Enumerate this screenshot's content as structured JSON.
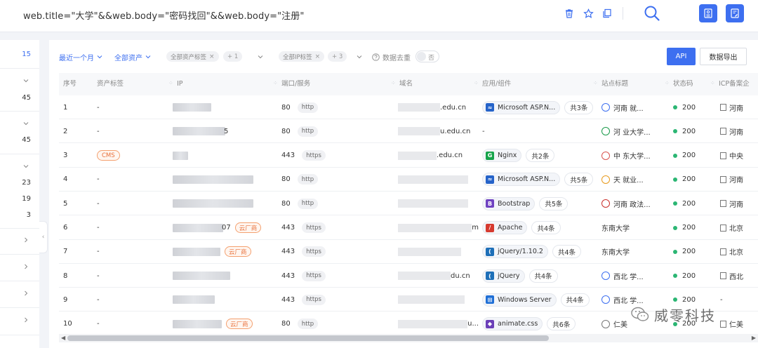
{
  "search": {
    "query": "web.title=\"大学\"&&web.body=\"密码找回\"&&web.body=\"注册\""
  },
  "facets": {
    "values": [
      "15",
      "45",
      "45",
      "23",
      "19",
      "3"
    ]
  },
  "filters": {
    "time": "最近一个月",
    "assets": "全部资产",
    "asset_tag_chip": "全部资产标签",
    "asset_tag_more": "+ 1",
    "ip_tag_chip": "全部IP标签",
    "ip_tag_more": "+ 3",
    "dedup_label": "数据去重",
    "dedup_state": "否"
  },
  "actions": {
    "api": "API",
    "export": "数据导出"
  },
  "table": {
    "columns": [
      "序号",
      "资产标签",
      "IP",
      "端口/服务",
      "域名",
      "应用/组件",
      "站点标题",
      "状态码",
      "ICP备案企"
    ],
    "rows": [
      {
        "no": "1",
        "tag": "-",
        "ip_tail": "",
        "cloud": "",
        "port": "80",
        "proto": "http",
        "domain_tail": ".edu.cn",
        "app": "Microsoft ASP.N...",
        "app_icon": "asp-icon",
        "count": "共3条",
        "title": "河南  就...",
        "status": "200",
        "icp": "河南"
      },
      {
        "no": "2",
        "tag": "-",
        "ip_tail": "5",
        "cloud": "",
        "port": "80",
        "proto": "http",
        "domain_tail": "u.edu.cn",
        "app": "-",
        "app_icon": "",
        "count": "",
        "title": "河  业大学...",
        "status": "200",
        "icp": "河南"
      },
      {
        "no": "3",
        "tag": "CMS",
        "ip_tail": "",
        "cloud": "",
        "port": "443",
        "proto": "https",
        "domain_tail": ".edu.cn",
        "app": "Nginx",
        "app_icon": "nginx-icon",
        "count": "共2条",
        "title": "中  东大学...",
        "status": "200",
        "icp": "中央"
      },
      {
        "no": "4",
        "tag": "-",
        "ip_tail": "",
        "cloud": "",
        "port": "80",
        "proto": "http",
        "domain_tail": "",
        "app": "Microsoft ASP.N...",
        "app_icon": "asp-icon",
        "count": "共5条",
        "title": "天  就业...",
        "status": "200",
        "icp": "河南"
      },
      {
        "no": "5",
        "tag": "-",
        "ip_tail": "",
        "cloud": "",
        "port": "80",
        "proto": "http",
        "domain_tail": "",
        "app": "Bootstrap",
        "app_icon": "bootstrap-icon",
        "count": "共5条",
        "title": "河南  政法...",
        "status": "200",
        "icp": "河南"
      },
      {
        "no": "6",
        "tag": "-",
        "ip_tail": "07",
        "cloud": "云厂商",
        "port": "443",
        "proto": "https",
        "domain_tail": "m",
        "app": "Apache",
        "app_icon": "apache-icon",
        "count": "共4条",
        "title": "东南大学",
        "status": "200",
        "icp": "北京"
      },
      {
        "no": "7",
        "tag": "-",
        "ip_tail": "",
        "cloud": "云厂商",
        "port": "443",
        "proto": "https",
        "domain_tail": "",
        "app": "jQuery/1.10.2",
        "app_icon": "jquery-icon",
        "count": "共4条",
        "title": "东南大学",
        "status": "200",
        "icp": "北京"
      },
      {
        "no": "8",
        "tag": "-",
        "ip_tail": "",
        "cloud": "",
        "port": "443",
        "proto": "https",
        "domain_tail": "du.cn",
        "app": "jQuery",
        "app_icon": "jquery-icon",
        "count": "共4条",
        "title": "西北  学...",
        "status": "200",
        "icp": "西北"
      },
      {
        "no": "9",
        "tag": "-",
        "ip_tail": "",
        "cloud": "",
        "port": "443",
        "proto": "https",
        "domain_tail": "",
        "app": "Windows Server",
        "app_icon": "windows-icon",
        "count": "共4条",
        "title": "西北  学...",
        "status": "200",
        "icp": "-"
      },
      {
        "no": "10",
        "tag": "-",
        "ip_tail": "",
        "cloud": "云厂商",
        "port": "80",
        "proto": "http",
        "domain_tail": "u...",
        "app": "animate.css",
        "app_icon": "animate-icon",
        "count": "共6条",
        "title": "仁美",
        "status": "200",
        "icp": "仁美"
      }
    ]
  },
  "watermark": {
    "text": "威零科技"
  },
  "colors": {
    "accent": "#3d6ff0",
    "ok": "#2bb673",
    "cloud_tag": "#e8703a"
  }
}
